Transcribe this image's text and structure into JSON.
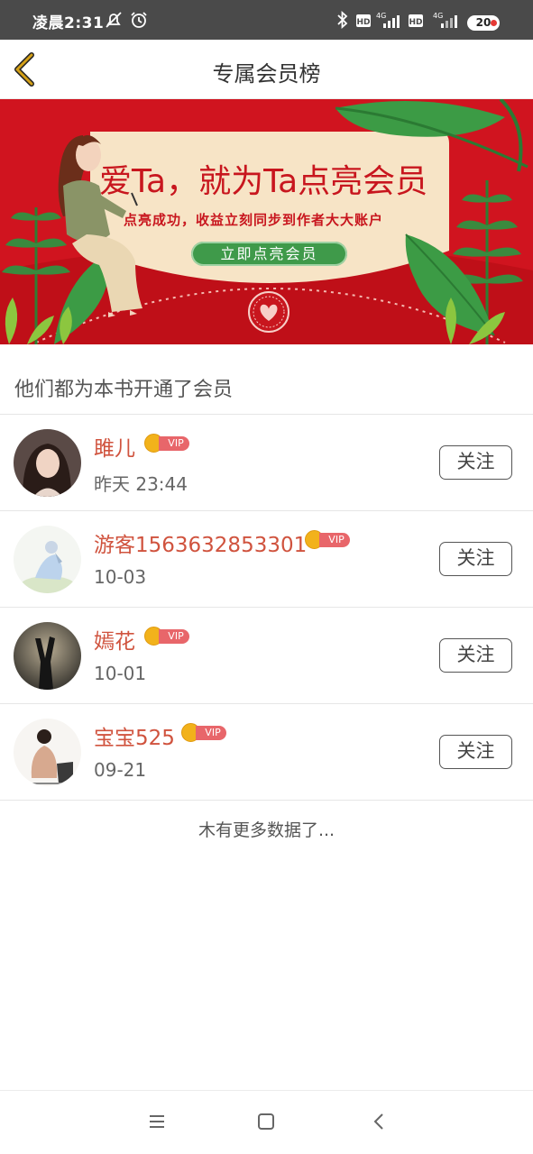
{
  "status_bar": {
    "time": "凌晨2:31",
    "battery": "20",
    "icons": [
      "mute-icon",
      "alarm-icon",
      "bluetooth-icon",
      "hd-icon",
      "signal-4g-icon",
      "hd-icon",
      "signal-4g-icon",
      "battery-icon"
    ]
  },
  "header": {
    "title": "专属会员榜",
    "back_icon": "chevron-left-icon",
    "back_color": "#d4a017"
  },
  "banner": {
    "headline": "爱Ta，就为Ta点亮会员",
    "subline": "点亮成功，收益立刻同步到作者大大账户",
    "cta_label": "立即点亮会员",
    "colors": {
      "background": "#d0141f",
      "card": "#f7e4c6",
      "cta": "#3f9a4a"
    }
  },
  "section": {
    "title": "他们都为本书开通了会员"
  },
  "members": [
    {
      "name": "雎儿",
      "time": "昨天 23:44",
      "vip_label": "VIP",
      "follow_label": "关注"
    },
    {
      "name": "游客1563632853301",
      "time": "10-03",
      "vip_label": "VIP",
      "follow_label": "关注"
    },
    {
      "name": "嫣花",
      "time": "10-01",
      "vip_label": "VIP",
      "follow_label": "关注"
    },
    {
      "name": "宝宝525",
      "time": "09-21",
      "vip_label": "VIP",
      "follow_label": "关注"
    }
  ],
  "footer_text": "木有更多数据了...",
  "colors": {
    "name": "#d0533e",
    "vip_tag": "#e8666a",
    "crown": "#f2b21b",
    "status_bar": "#4a4a4a"
  },
  "bottom_nav": {
    "icons": [
      "menu-icon",
      "home-square-icon",
      "back-arrow-icon"
    ]
  }
}
